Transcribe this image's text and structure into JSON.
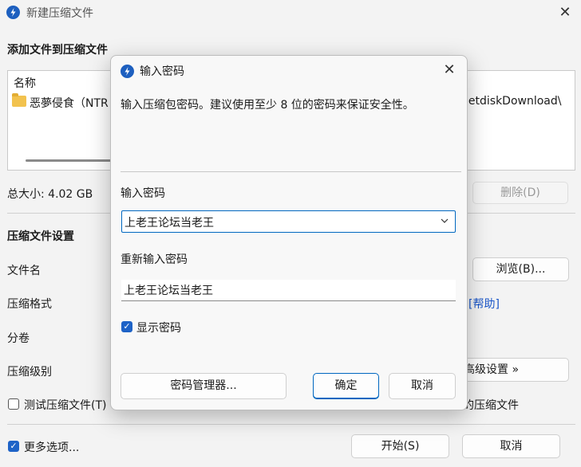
{
  "window": {
    "title": "新建压缩文件",
    "close_glyph": "✕"
  },
  "files_section": {
    "title": "添加文件到压缩文件",
    "column_name": "名称",
    "file_name": "恶夢侵食（NTR",
    "file_path_partial": "letdiskDownload\\"
  },
  "total_size": "总大小: 4.02 GB",
  "delete_button": "删除(D)",
  "settings": {
    "title": "压缩文件设置",
    "file_name_label": "文件名",
    "browse_button": "浏览(B)...",
    "format_label": "压缩格式",
    "help_link": "[帮助]",
    "split_label": "分卷",
    "level_label": "压缩级别",
    "advanced_button": "高级设置 »",
    "test_checkbox_label": "测试压缩文件(T)",
    "test_checked": false,
    "partial_label": "的压缩文件"
  },
  "footer": {
    "more_options_label": "更多选项...",
    "more_options_checked": true,
    "start_button": "开始(S)",
    "cancel_button": "取消"
  },
  "dialog": {
    "title": "输入密码",
    "close_glyph": "✕",
    "hint": "输入压缩包密码。建议使用至少 8 位的密码来保证安全性。",
    "password_label": "输入密码",
    "password_value": "上老王论坛当老王",
    "reenter_label": "重新输入密码",
    "reenter_value": "上老王论坛当老王",
    "show_password_label": "显示密码",
    "show_password_checked": true,
    "manager_button": "密码管理器...",
    "ok_button": "确定",
    "cancel_button": "取消"
  },
  "colors": {
    "accent": "#0067c0",
    "link": "#1a56c8",
    "icon_blue": "#1d5fbf"
  },
  "icons": [
    "app-logo-icon",
    "close-icon",
    "folder-icon",
    "chevron-down-icon",
    "check-icon"
  ]
}
